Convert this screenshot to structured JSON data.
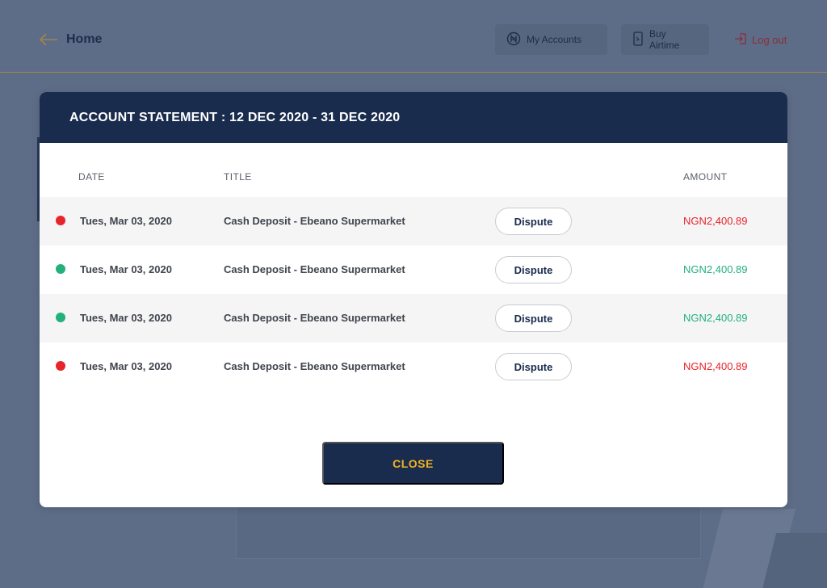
{
  "colors": {
    "navy": "#1a2c4e",
    "debit": "#e8242b",
    "credit": "#22b07d",
    "gold": "#f2b321",
    "overlay": "#5e6d87"
  },
  "nav": {
    "back_icon": "arrow-left-icon",
    "home_label": "Home",
    "my_accounts_label": "My Accounts",
    "my_accounts_icon": "naira-circle-icon",
    "buy_airtime_label": "Buy Airtime",
    "buy_airtime_icon": "phone-icon",
    "logout_label": "Log out",
    "logout_icon": "logout-icon"
  },
  "modal": {
    "title": "ACCOUNT STATEMENT : 12 DEC 2020 - 31 DEC 2020",
    "columns": {
      "date": "DATE",
      "title": "TITLE",
      "amount": "AMOUNT"
    },
    "rows": [
      {
        "status": "debit",
        "date": "Tues, Mar 03, 2020",
        "title": "Cash Deposit - Ebeano Supermarket",
        "action": "Dispute",
        "amount": "NGN2,400.89"
      },
      {
        "status": "credit",
        "date": "Tues, Mar 03, 2020",
        "title": "Cash Deposit - Ebeano Supermarket",
        "action": "Dispute",
        "amount": "NGN2,400.89"
      },
      {
        "status": "credit",
        "date": "Tues, Mar 03, 2020",
        "title": "Cash Deposit - Ebeano Supermarket",
        "action": "Dispute",
        "amount": "NGN2,400.89"
      },
      {
        "status": "debit",
        "date": "Tues, Mar 03, 2020",
        "title": "Cash Deposit - Ebeano Supermarket",
        "action": "Dispute",
        "amount": "NGN2,400.89"
      }
    ],
    "close_label": "CLOSE"
  }
}
